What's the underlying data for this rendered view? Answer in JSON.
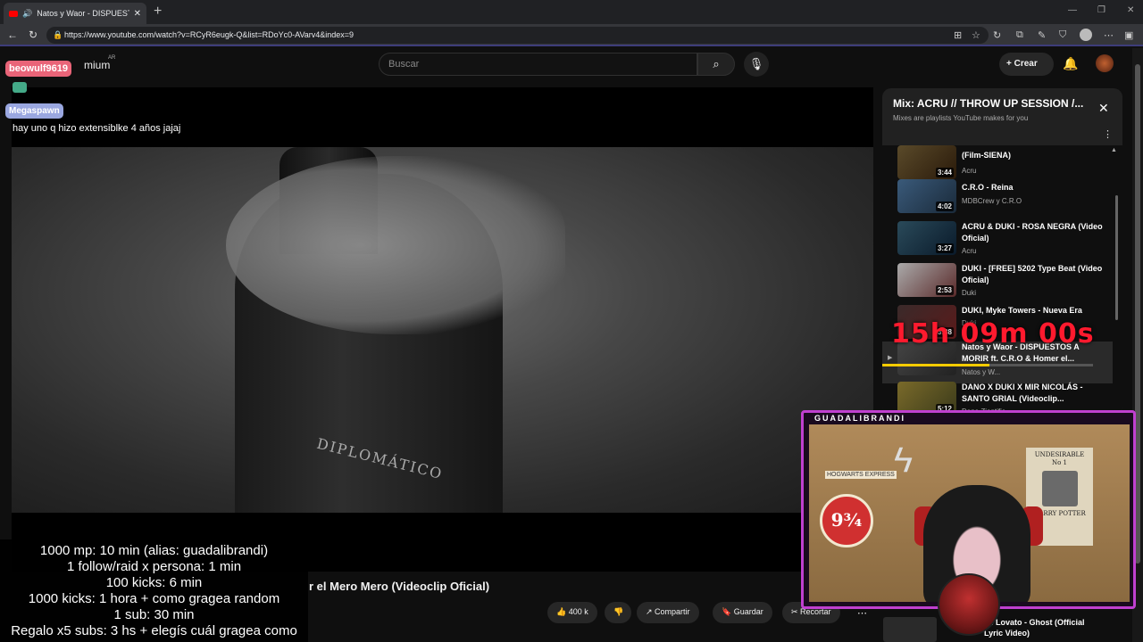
{
  "browser": {
    "tab_title": "Natos y Waor - DISPUESTOS",
    "url": "https://www.youtube.com/watch?v=RCyR6eugk-Q&list=RDoYc0-AVarv4&index=9"
  },
  "youtube": {
    "logo_text": "mium",
    "logo_sup": "AR",
    "search_placeholder": "Buscar",
    "create_label": "Crear"
  },
  "chat": {
    "user1": "beowulf9619",
    "user2": "Megaspawn",
    "message": "hay uno q hizo extensiblke 4 años jajaj"
  },
  "video": {
    "bottle_label": "DIPLOMÁTICO",
    "title": "r el Mero Mero (Videoclip Oficial)",
    "likes": "400 k",
    "share_label": "Compartir",
    "save_label": "Guardar",
    "clip_label": "Recortar"
  },
  "rules": [
    "1000 mp: 10 min (alias: guadalibrandi)",
    "1 follow/raid x persona: 1 min",
    "100 kicks: 6 min",
    "1000 kicks: 1 hora + como gragea random",
    "1 sub: 30 min",
    "Regalo x5 subs: 3 hs + elegís cuál gragea como"
  ],
  "mix": {
    "title": "Mix: ACRU // THROW UP SESSION /...",
    "subtitle": "Mixes are playlists YouTube makes for you",
    "items": [
      {
        "title": "(Film-SIENA)",
        "channel": "Acru",
        "duration": "3:44"
      },
      {
        "title": "C.R.O - Reina",
        "channel": "MDBCrew y C.R.O",
        "duration": "4:02"
      },
      {
        "title": "ACRU & DUKI - ROSA NEGRA (Video Oficial)",
        "channel": "Acru",
        "duration": "3:27"
      },
      {
        "title": "DUKI - [FREE] 5202 Type Beat (Video Oficial)",
        "channel": "Duki",
        "duration": "2:53"
      },
      {
        "title": "DUKI, Myke Towers - Nueva Era",
        "channel": "Duki",
        "duration": "3:38"
      },
      {
        "title": "Natos y Waor - DISPUESTOS A MORIR ft. C.R.O & Homer el...",
        "channel": "Natos y W...",
        "duration": ""
      },
      {
        "title": "DANO X DUKI X MIR NICOLÁS - SANTO GRIAL (Videoclip...",
        "channel": "Dano Ziontific",
        "duration": "5:12"
      }
    ],
    "current_progress": 0.51
  },
  "overlay": {
    "timer": "15h 09m 00s",
    "streamer": "GUADALIBRANDI",
    "poster_hogwarts": "HOGWARTS EXPRESS",
    "poster_platform": "9¾",
    "wanted_title": "UNDESIRABLE",
    "wanted_no": "No 1",
    "wanted_name": "HARRY POTTER"
  },
  "next_video": {
    "title": "mi Lovato - Ghost (Official Lyric Video)"
  }
}
